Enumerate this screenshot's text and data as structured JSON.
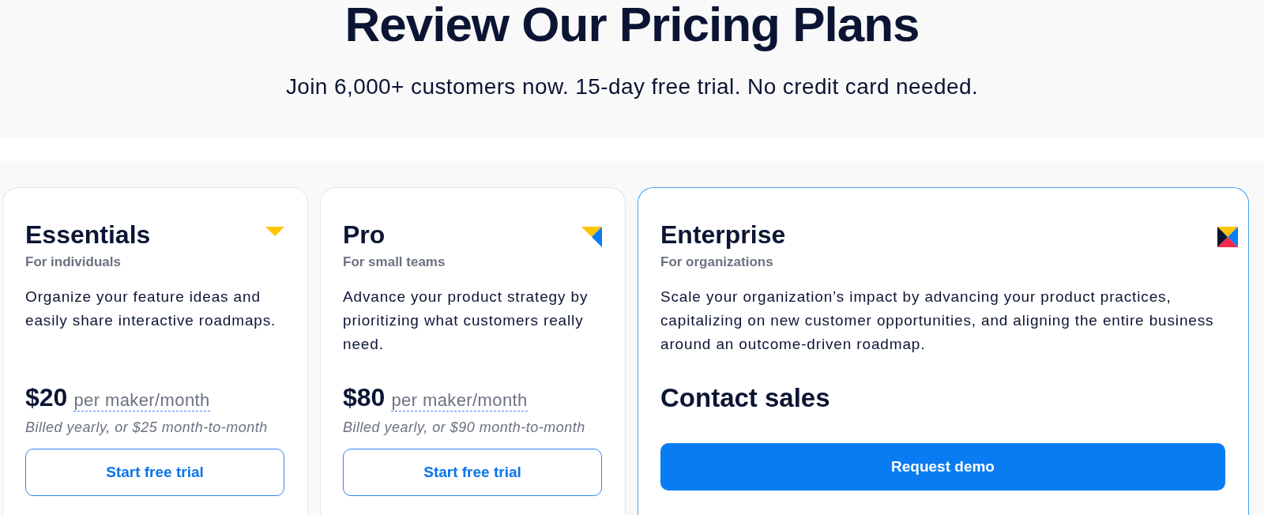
{
  "header": {
    "title": "Review Our Pricing Plans",
    "subtitle": "Join 6,000+ customers now. 15-day free trial. No credit card needed."
  },
  "plans": [
    {
      "kind": "priced",
      "name": "Essentials",
      "audience": "For individuals",
      "description": "Organize your feature ideas and easily share interactive roadmaps.",
      "highlighted": false,
      "price": "$20",
      "unit": "per maker/month",
      "billing": "Billed yearly, or $25 month-to-month",
      "button": {
        "kind": "outline",
        "label": "Start free trial"
      }
    },
    {
      "kind": "priced",
      "name": "Pro",
      "audience": "For small teams",
      "description": "Advance your product strategy by prioritizing what customers really need.",
      "highlighted": false,
      "price": "$80",
      "unit": "per maker/month",
      "billing": "Billed yearly, or $90 month-to-month",
      "button": {
        "kind": "outline",
        "label": "Start free trial"
      }
    },
    {
      "kind": "contact",
      "name": "Enterprise",
      "audience": "For organizations",
      "description": "Scale your organization’s impact by advancing your product practices, capitalizing on new customer opportunities, and aligning the entire business around an outcome-driven roadmap.",
      "highlighted": true,
      "contact": "Contact sales",
      "button": {
        "kind": "filled",
        "label": "Request demo"
      }
    }
  ]
}
